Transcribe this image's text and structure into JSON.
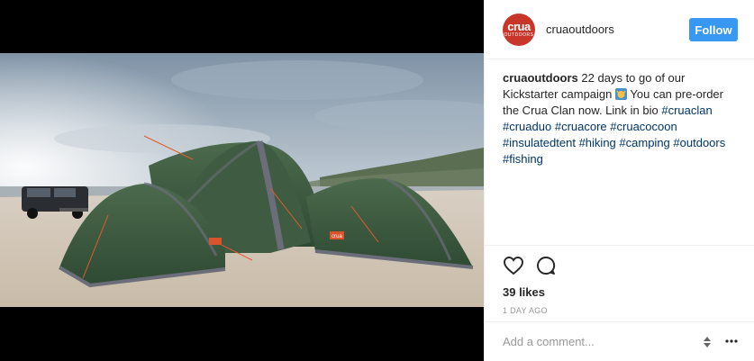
{
  "post": {
    "username": "cruaoutdoors",
    "follow_label": "Follow",
    "avatar_text_main": "crua",
    "avatar_text_sub": "OUTDOORS"
  },
  "caption": {
    "username": "cruaoutdoors",
    "text_1": "22 days to go of our Kickstarter campaign",
    "text_2": "You can pre-order the Crua Clan now. Link in bio",
    "hashtags": [
      "#cruaclan",
      "#cruaduo",
      "#cruacore",
      "#cruacocoon",
      "#insulatedtent",
      "#hiking",
      "#camping",
      "#outdoors",
      "#fishing"
    ]
  },
  "stats": {
    "likes": "39 likes",
    "time": "1 DAY AGO"
  },
  "comment": {
    "placeholder": "Add a comment..."
  },
  "photo": {
    "tent_label": "crua"
  },
  "icons": {
    "like": "heart-icon",
    "comment": "comment-bubble-icon",
    "more": "ellipsis-icon",
    "stepper": "up-down-arrows-icon"
  },
  "colors": {
    "follow": "#3897f0",
    "hashtag": "#003569",
    "avatar": "#c8362a",
    "tent": "#3e5a3f"
  }
}
